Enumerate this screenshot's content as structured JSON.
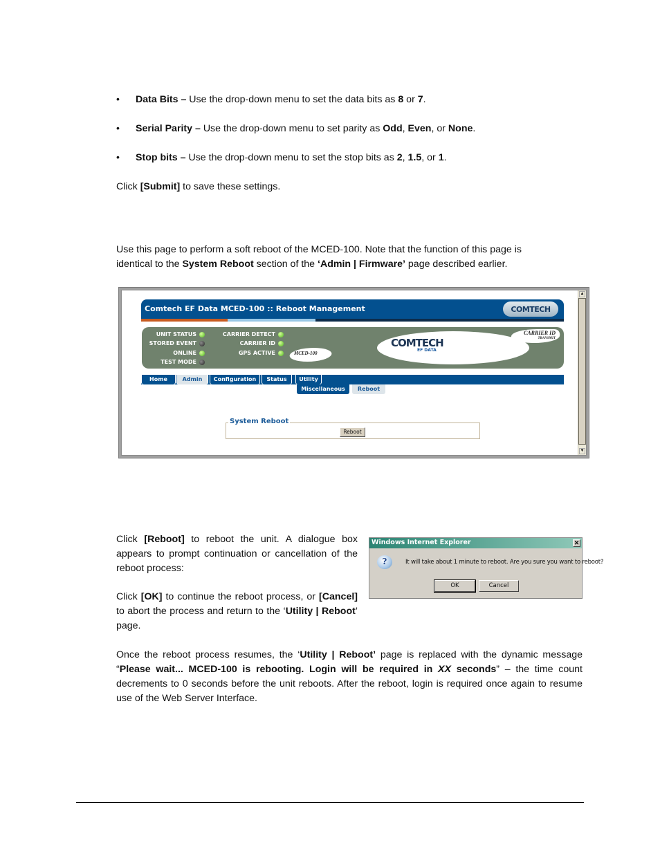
{
  "settings_list": [
    {
      "label": "Data Bits ",
      "sep": " – ",
      "text": "Use the drop-down menu to set the data bits as ",
      "options": [
        "8",
        "7"
      ],
      "joiners": [
        " or ",
        "."
      ]
    },
    {
      "label": "Serial Parity",
      "sep": " – ",
      "text": "Use the drop-down menu to set parity as ",
      "options": [
        "Odd",
        "Even",
        "None"
      ],
      "joiners": [
        ", ",
        ", or ",
        "."
      ]
    },
    {
      "label": "Stop bits",
      "sep": " – ",
      "text": "Use the drop-down menu to set the stop bits as ",
      "options": [
        "2",
        "1.5",
        "1"
      ],
      "joiners": [
        ", ",
        ", or ",
        "."
      ]
    }
  ],
  "submit_note": {
    "pre": "Click ",
    "button": "[Submit]",
    "post": " to save these settings."
  },
  "intro": {
    "line1": "Use this page to perform a soft reboot of the MCED-100. Note that the function of this page is",
    "pre": "identical to the ",
    "bold1": "System Reboot",
    "mid": " section of the ",
    "bold2": "‘Admin | Firmware’",
    "post": " page described earlier."
  },
  "web_ui": {
    "title": "Comtech EF Data MCED-100 :: Reboot Management",
    "brand": "COMTECH",
    "brand_sub": "EF DATA",
    "model": "MCED-100",
    "carrier_id_badge": "CARRIER ID",
    "carrier_id_sub": "TRANSMIT",
    "stripe_colors": [
      "#c75b21",
      "#9ac8e6",
      "#0c2b4a"
    ],
    "leds_left": [
      {
        "label": "UNIT STATUS",
        "state": "on"
      },
      {
        "label": "STORED EVENT",
        "state": "off"
      },
      {
        "label": "ONLINE",
        "state": "on"
      },
      {
        "label": "TEST MODE",
        "state": "off"
      }
    ],
    "leds_right": [
      {
        "label": "CARRIER DETECT",
        "state": "on"
      },
      {
        "label": "CARRIER ID",
        "state": "on"
      },
      {
        "label": "GPS ACTIVE",
        "state": "on"
      }
    ],
    "nav_tabs": [
      {
        "label": "Home",
        "active": false
      },
      {
        "label": "Admin",
        "active": true
      },
      {
        "label": "Configuration",
        "active": false
      },
      {
        "label": "Status",
        "active": false
      },
      {
        "label": "Utility",
        "active": false
      }
    ],
    "sub_tabs": [
      {
        "label": "Miscellaneous",
        "active": false
      },
      {
        "label": "Reboot",
        "active": true
      }
    ],
    "section_title": "System Reboot",
    "reboot_button": "Reboot"
  },
  "reboot_instructions": {
    "p1_pre": "Click ",
    "p1_btn": "[Reboot]",
    "p1_post": " to reboot the unit. A dialogue box appears to prompt continuation or cancellation of the reboot process:",
    "p2_pre": "Click ",
    "p2_ok": "[OK]",
    "p2_mid": " to continue the reboot process, or ",
    "p2_cancel": "[Cancel]",
    "p2_mid2": " to abort the process and return to the ‘",
    "p2_page": "Utility | Reboot",
    "p2_post": "’ page."
  },
  "dialog": {
    "title": "Windows Internet Explorer",
    "close_glyph": "✕",
    "icon_glyph": "?",
    "message": "It will take about 1 minute to reboot. Are you sure you want to reboot?",
    "ok": "OK",
    "cancel": "Cancel"
  },
  "closing": {
    "pre": "Once the reboot process resumes, the ‘",
    "page": "Utility | Reboot’",
    "mid": " page is replaced with the dynamic message “",
    "msg1": "Please wait... MCED-100 is rebooting. Login will be required in ",
    "msg_var": "XX",
    "msg2": " seconds",
    "post": "” – the time count decrements to 0 seconds before the unit reboots. After the reboot, login is required once again to resume use of the Web Server Interface."
  },
  "bullet_glyph": "•"
}
